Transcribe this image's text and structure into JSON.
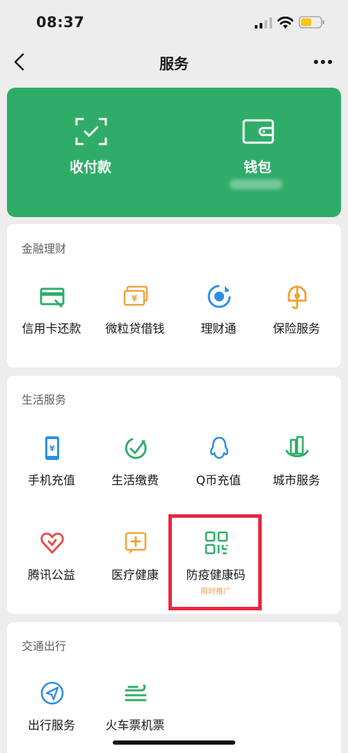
{
  "status_bar": {
    "time": "08:37"
  },
  "nav": {
    "title": "服务"
  },
  "pay_card": {
    "items": [
      {
        "label": "收付款",
        "icon": "scan-pay-icon"
      },
      {
        "label": "钱包",
        "icon": "wallet-icon"
      }
    ]
  },
  "sections": [
    {
      "title": "金融理财",
      "items": [
        {
          "label": "信用卡还款",
          "icon": "credit-card-icon",
          "color": "#2fad68"
        },
        {
          "label": "微粒贷借钱",
          "icon": "money-bill-icon",
          "color": "#f0a23a"
        },
        {
          "label": "理财通",
          "icon": "wealth-icon",
          "color": "#2d8ee8"
        },
        {
          "label": "保险服务",
          "icon": "insurance-icon",
          "color": "#f0a23a"
        }
      ]
    },
    {
      "title": "生活服务",
      "items": [
        {
          "label": "手机充值",
          "icon": "phone-icon",
          "color": "#2d8ee8"
        },
        {
          "label": "生活缴费",
          "icon": "check-circle-icon",
          "color": "#2fad68"
        },
        {
          "label": "Q币充值",
          "icon": "qq-penguin-icon",
          "color": "#2d8ee8"
        },
        {
          "label": "城市服务",
          "icon": "city-icon",
          "color": "#2fad68"
        },
        {
          "label": "腾讯公益",
          "icon": "charity-heart-icon",
          "color": "#e54d4d"
        },
        {
          "label": "医疗健康",
          "icon": "medical-icon",
          "color": "#f0a23a"
        },
        {
          "label": "防疫健康码",
          "icon": "qr-code-icon",
          "color": "#2fad68",
          "sub": "限时推广"
        }
      ]
    },
    {
      "title": "交通出行",
      "items": [
        {
          "label": "出行服务",
          "icon": "navigation-icon",
          "color": "#2d8ee8"
        },
        {
          "label": "火车票机票",
          "icon": "train-icon",
          "color": "#2fad68"
        }
      ]
    }
  ]
}
